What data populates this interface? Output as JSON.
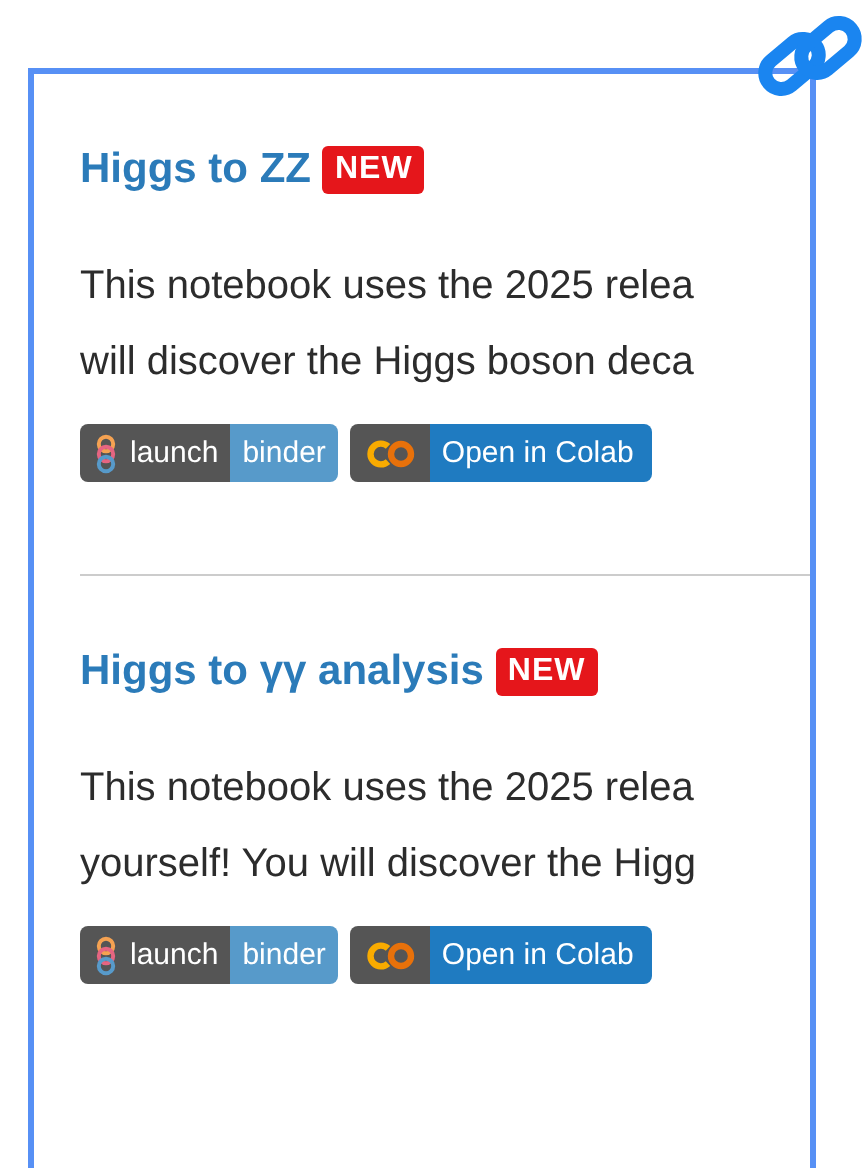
{
  "notebooks": [
    {
      "title": "Higgs to ZZ",
      "badge": "NEW",
      "description": [
        "This notebook uses the 2025 relea",
        "will discover the Higgs boson deca"
      ],
      "launchers": [
        {
          "kind": "binder",
          "left": "launch",
          "right": "binder"
        },
        {
          "kind": "colab",
          "right": "Open in Colab"
        }
      ]
    },
    {
      "title": "Higgs to γγ analysis",
      "badge": "NEW",
      "description": [
        "This notebook uses the 2025 relea",
        "yourself! You will discover the Higg"
      ],
      "launchers": [
        {
          "kind": "binder",
          "left": "launch",
          "right": "binder"
        },
        {
          "kind": "colab",
          "right": "Open in Colab"
        }
      ]
    }
  ]
}
